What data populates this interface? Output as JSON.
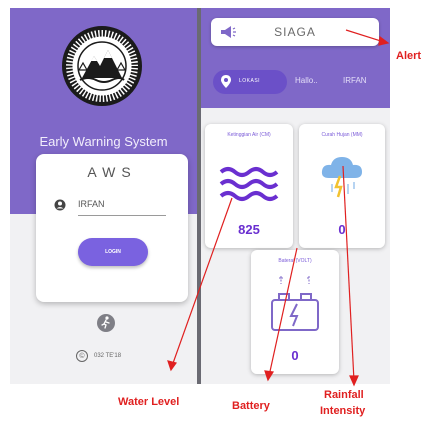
{
  "login_screen": {
    "logo_text": "AWS • WASPADA • SIAGA • 2020 • 10 BOS TE'18 WIN BOS",
    "app_title": "Early Warning System",
    "card_title": "AWS",
    "username": "IRFAN",
    "login_label": "LOGIN",
    "copyright": "032 TE'18"
  },
  "dashboard": {
    "alert_status": "SIAGA",
    "location_button": "LOKASI",
    "greeting": "Hallo..",
    "user_name": "IRFAN",
    "water_level": {
      "label": "Ketinggian Air (CM)",
      "value": "825"
    },
    "rainfall": {
      "label": "Curah Hujan (MM)",
      "value": "0"
    },
    "battery": {
      "label": "Baterai (VOLT)",
      "value": "0"
    }
  },
  "annotations": {
    "alert": "Alert",
    "water_level": "Water Level",
    "battery": "Battery",
    "rainfall_line1": "Rainfall",
    "rainfall_line2": "Intensity"
  },
  "colors": {
    "primary_purple": "#7f68c8",
    "button_purple": "#7a62e0",
    "value_purple": "#6a2fd0",
    "annotation_red": "#e02020"
  },
  "icons": [
    "user-icon",
    "run-icon",
    "megaphone-icon",
    "pin-icon",
    "water-waves-icon",
    "rain-cloud-icon",
    "battery-icon"
  ]
}
